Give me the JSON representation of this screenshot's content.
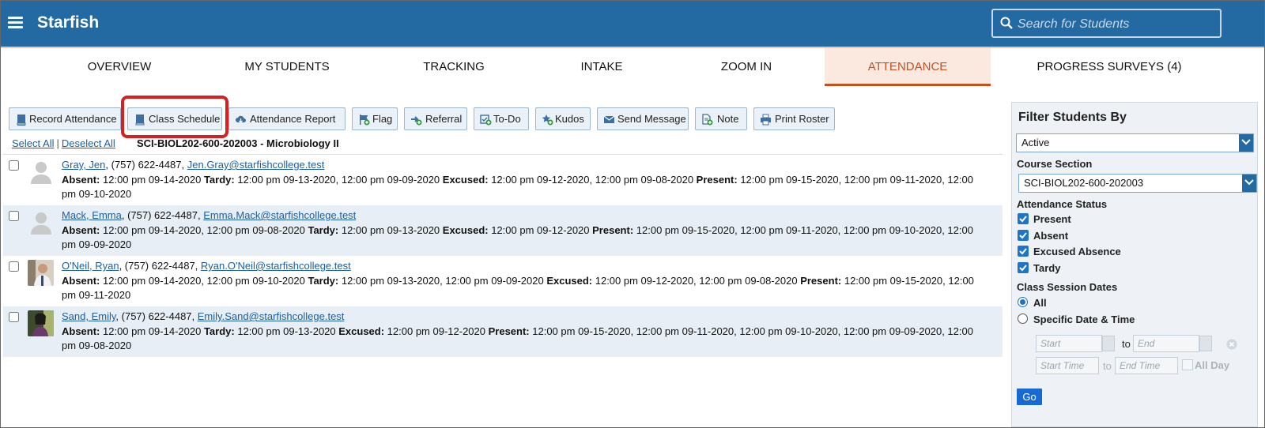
{
  "header": {
    "app_name": "Starfish",
    "search_placeholder": "Search for Students",
    "menu_icon": "hamburger-menu-icon",
    "search_icon": "search-icon"
  },
  "tabs": [
    {
      "label": "OVERVIEW"
    },
    {
      "label": "MY STUDENTS"
    },
    {
      "label": "TRACKING"
    },
    {
      "label": "INTAKE"
    },
    {
      "label": "ZOOM IN"
    },
    {
      "label": "ATTENDANCE",
      "active": true
    },
    {
      "label": "PROGRESS SURVEYS (4)"
    }
  ],
  "toolbar": {
    "record_attendance": "Record Attendance",
    "class_schedule": "Class Schedule",
    "attendance_report": "Attendance Report",
    "flag": "Flag",
    "referral": "Referral",
    "todo": "To-Do",
    "kudos": "Kudos",
    "send_message": "Send Message",
    "note": "Note",
    "print_roster": "Print Roster"
  },
  "selection": {
    "select_all": "Select All",
    "separator": "|",
    "deselect_all": "Deselect All",
    "course_title": "SCI-BIOL202-600-202003 - Microbiology II"
  },
  "students": [
    {
      "name": "Gray, Jen",
      "phone": ", (757) 622-4487, ",
      "email": "Jen.Gray@starfishcollege.test",
      "line2_prefix": "Absent:",
      "line2": [
        {
          "k": "Absent:",
          "v": " 12:00 pm 09-14-2020 "
        },
        {
          "k": "Tardy:",
          "v": " 12:00 pm 09-13-2020, 12:00 pm 09-09-2020 "
        },
        {
          "k": "Excused:",
          "v": " 12:00 pm 09-12-2020, 12:00 pm 09-08-2020 "
        },
        {
          "k": "Present:",
          "v": " 12:00 pm 09-15-2020, 12:00 pm 09-11-2020, 12:00 pm 09-10-2020"
        }
      ]
    },
    {
      "name": "Mack, Emma",
      "phone": ", (757) 622-4487, ",
      "email": "Emma.Mack@starfishcollege.test",
      "line2": [
        {
          "k": "Absent:",
          "v": " 12:00 pm 09-14-2020, 12:00 pm 09-08-2020 "
        },
        {
          "k": "Tardy:",
          "v": " 12:00 pm 09-13-2020 "
        },
        {
          "k": "Excused:",
          "v": " 12:00 pm 09-12-2020 "
        },
        {
          "k": "Present:",
          "v": " 12:00 pm 09-15-2020, 12:00 pm 09-11-2020, 12:00 pm 09-10-2020, 12:00 pm 09-09-2020"
        }
      ]
    },
    {
      "name": "O'Neil, Ryan",
      "phone": ", (757) 622-4487, ",
      "email": "Ryan.O'Neil@starfishcollege.test",
      "line2": [
        {
          "k": "Absent:",
          "v": " 12:00 pm 09-14-2020, 12:00 pm 09-10-2020 "
        },
        {
          "k": "Tardy:",
          "v": " 12:00 pm 09-13-2020, 12:00 pm 09-09-2020 "
        },
        {
          "k": "Excused:",
          "v": " 12:00 pm 09-12-2020, 12:00 pm 09-08-2020 "
        },
        {
          "k": "Present:",
          "v": " 12:00 pm 09-15-2020, 12:00 pm 09-11-2020"
        }
      ]
    },
    {
      "name": "Sand, Emily",
      "phone": ", (757) 622-4487, ",
      "email": "Emily.Sand@starfishcollege.test",
      "line2": [
        {
          "k": "Absent:",
          "v": " 12:00 pm 09-14-2020 "
        },
        {
          "k": "Tardy:",
          "v": " 12:00 pm 09-13-2020 "
        },
        {
          "k": "Excused:",
          "v": " 12:00 pm 09-12-2020 "
        },
        {
          "k": "Present:",
          "v": " 12:00 pm 09-15-2020, 12:00 pm 09-11-2020, 12:00 pm 09-10-2020, 12:00 pm 09-09-2020, 12:00 pm 09-08-2020"
        }
      ]
    }
  ],
  "filter": {
    "title": "Filter Students By",
    "status_value": "Active",
    "course_section_label": "Course Section",
    "course_section_value": "SCI-BIOL202-600-202003",
    "attendance_status_label": "Attendance Status",
    "status_options": [
      "Present",
      "Absent",
      "Excused Absence",
      "Tardy"
    ],
    "session_dates_label": "Class Session Dates",
    "all_label": "All",
    "specific_label": "Specific Date & Time",
    "start_placeholder": "Start",
    "end_placeholder": "End",
    "to_label": "to",
    "start_time_placeholder": "Start Time",
    "end_time_placeholder": "End Time",
    "all_day_label": "All Day",
    "go_label": "Go"
  },
  "colors": {
    "brand_blue": "#2369a2",
    "active_tab_text": "#c4521f",
    "active_tab_bg": "#fbe8df",
    "highlight_red": "#d52121",
    "row_alt": "#e7eef5"
  }
}
